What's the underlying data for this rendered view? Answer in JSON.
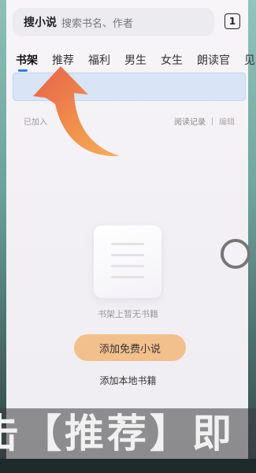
{
  "search": {
    "brand": "搜小说",
    "placeholder": "搜索书名、作者"
  },
  "tab_count": "1",
  "tabs": [
    {
      "label": "书架",
      "active": true
    },
    {
      "label": "推荐",
      "active": false
    },
    {
      "label": "福利",
      "active": false
    },
    {
      "label": "男生",
      "active": false
    },
    {
      "label": "女生",
      "active": false
    },
    {
      "label": "朗读官",
      "active": false
    },
    {
      "label": "见",
      "active": false
    }
  ],
  "shelf": {
    "added_label": "已加入",
    "read_record": "阅读记录",
    "edit": "编辑"
  },
  "empty": {
    "message": "书架上暂无书籍",
    "add_free_button": "添加免费小说",
    "add_local": "添加本地书籍"
  },
  "caption": "击【推荐】即",
  "colors": {
    "accent_blue": "#2f7fd9",
    "button_orange": "#f2c08d",
    "arrow_orange": "#f08a3e"
  },
  "icons": {
    "arrow": "curved-up-arrow-icon",
    "floating": "floating-ball-icon"
  }
}
